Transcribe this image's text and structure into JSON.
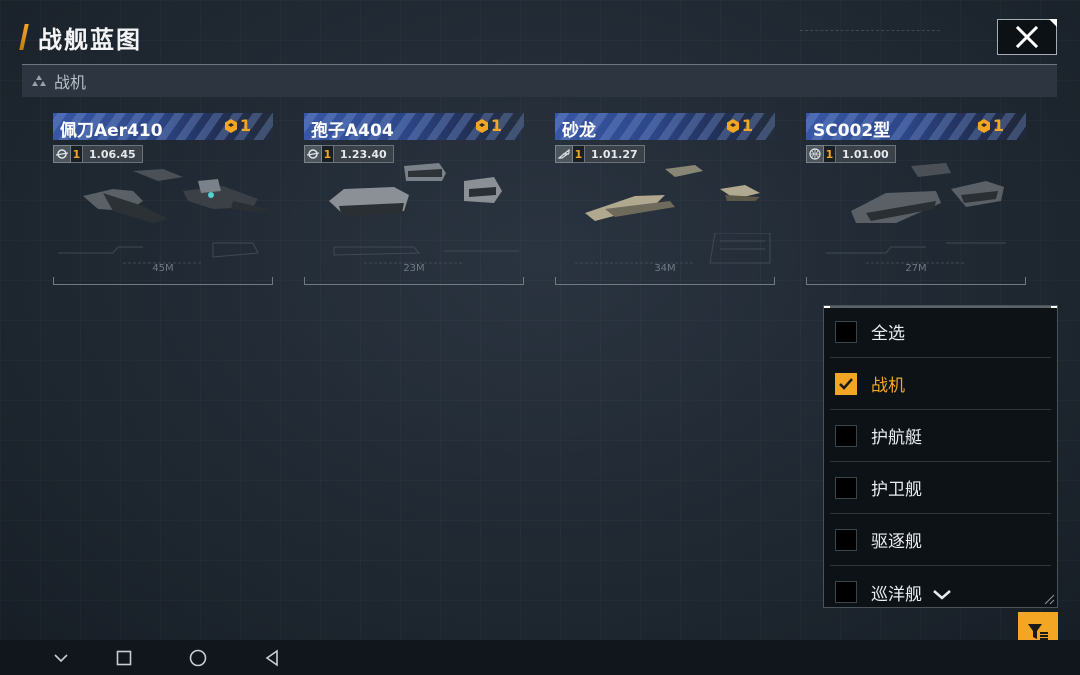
{
  "header": {
    "title": "战舰蓝图"
  },
  "category": {
    "label": "战机"
  },
  "cards": [
    {
      "name": "佩刀Aer410",
      "count": "1",
      "type_icon": "planet-icon",
      "level": "1",
      "version": "1.06.45",
      "size": "45M"
    },
    {
      "name": "孢子A404",
      "count": "1",
      "type_icon": "planet-icon",
      "level": "1",
      "version": "1.23.40",
      "size": "23M"
    },
    {
      "name": "砂龙",
      "count": "1",
      "type_icon": "faction-icon",
      "level": "1",
      "version": "1.01.27",
      "size": "34M"
    },
    {
      "name": "SC002型",
      "count": "1",
      "type_icon": "globe-icon",
      "level": "1",
      "version": "1.01.00",
      "size": "27M"
    }
  ],
  "filter": {
    "items": [
      {
        "label": "全选",
        "checked": false
      },
      {
        "label": "战机",
        "checked": true
      },
      {
        "label": "护航艇",
        "checked": false
      },
      {
        "label": "护卫舰",
        "checked": false
      },
      {
        "label": "驱逐舰",
        "checked": false
      },
      {
        "label": "巡洋舰",
        "checked": false
      }
    ]
  },
  "colors": {
    "accent": "#f2a623",
    "card_header": "#3857a6",
    "background": "#1f2832"
  }
}
